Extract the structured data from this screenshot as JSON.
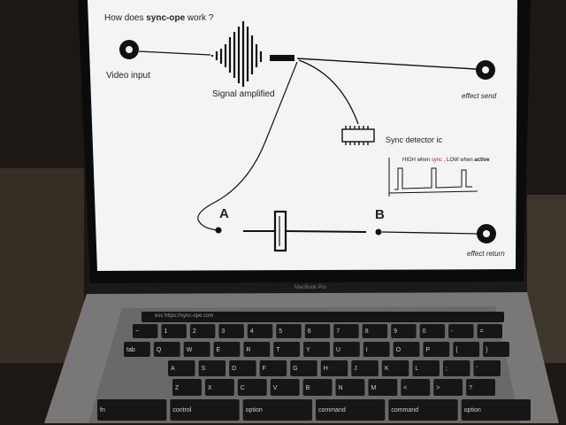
{
  "slide": {
    "title_prefix": "How does ",
    "title_bold": "sync-ope",
    "title_suffix": " work ?",
    "video_input": "Video input",
    "signal_amplified": "Signal amplified",
    "effect_send": "effect send",
    "sync_detector": "Sync detector ic",
    "waveform_label": {
      "pre": "HIGH when ",
      "sync": "sync",
      "mid": " , LOW when ",
      "active": "active"
    },
    "point_a": "A",
    "point_b": "B",
    "effect_return": "effect return"
  },
  "laptop": {
    "brand": "MacBook Pro",
    "touchbar_text": "esc   https://sync-ope.com"
  },
  "keyboard": {
    "row1": [
      "~",
      "1",
      "2",
      "3",
      "4",
      "5",
      "6",
      "7",
      "8",
      "9",
      "0",
      "-",
      "="
    ],
    "row2": [
      "tab",
      "Q",
      "W",
      "E",
      "R",
      "T",
      "Y",
      "U",
      "I",
      "O",
      "P",
      "{",
      "}"
    ],
    "row3": [
      "A",
      "S",
      "D",
      "F",
      "G",
      "H",
      "J",
      "K",
      "L",
      ";",
      "'"
    ],
    "row4": [
      "Z",
      "X",
      "C",
      "V",
      "B",
      "N",
      "M",
      "<",
      ">",
      "?"
    ],
    "row5": [
      "fn",
      "control",
      "option",
      "command",
      "command",
      "option"
    ]
  },
  "colors": {
    "screen": "#f4f4f4",
    "bezel": "#0c0c0c",
    "key": "#161616",
    "sync_text": "#cc2222",
    "background": "#1b1712"
  }
}
